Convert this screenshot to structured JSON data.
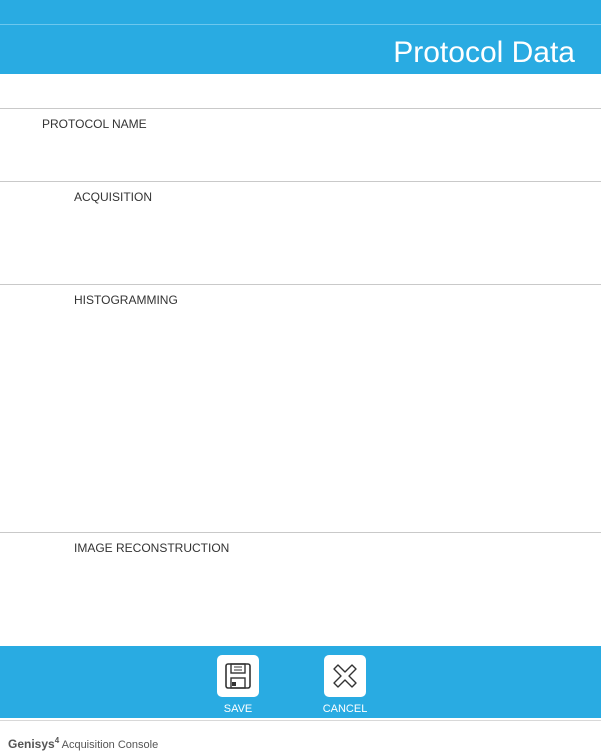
{
  "header": {
    "title": "Protocol Data",
    "accent_color": "#29ABE2"
  },
  "sections": [
    {
      "label": "PROTOCOL NAME"
    },
    {
      "label": "ACQUISITION"
    },
    {
      "label": "HISTOGRAMMING"
    },
    {
      "label": "IMAGE RECONSTRUCTION"
    }
  ],
  "actions": {
    "save": {
      "label": "SAVE",
      "icon": "save-icon"
    },
    "cancel": {
      "label": "CANCEL",
      "icon": "close-icon"
    }
  },
  "footer": {
    "brand": "Genisys",
    "brand_superscript": "4",
    "subtitle": "Acquisition Console"
  }
}
